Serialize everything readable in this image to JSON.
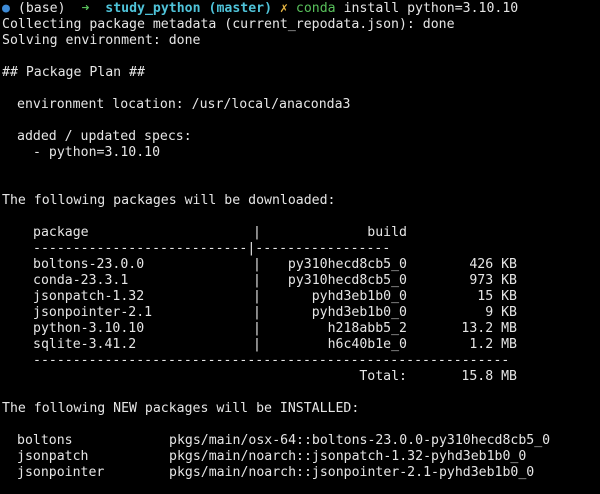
{
  "prompt": {
    "dot": "●",
    "env": "(base)",
    "arrow": "➜",
    "dir": "study_python",
    "branch": "(master)",
    "dirty": "✗",
    "command_name": "conda",
    "command_args": "install python=3.10.10"
  },
  "collect_line": "Collecting package metadata (current_repodata.json): done",
  "solve_line": "Solving environment: done",
  "plan_heading": "## Package Plan ##",
  "env_location": "environment location: /usr/local/anaconda3",
  "specs_heading": "added / updated specs:",
  "specs": [
    "- python=3.10.10"
  ],
  "download_heading": "The following packages will be downloaded:",
  "table": {
    "col_package": "package",
    "col_build": "build",
    "header_rule": "---------------------------|-----------------",
    "rows": [
      {
        "package": "boltons-23.0.0",
        "build": "py310hecd8cb5_0",
        "size": "426 KB"
      },
      {
        "package": "conda-23.3.1",
        "build": "py310hecd8cb5_0",
        "size": "973 KB"
      },
      {
        "package": "jsonpatch-1.32",
        "build": "pyhd3eb1b0_0",
        "size": "15 KB"
      },
      {
        "package": "jsonpointer-2.1",
        "build": "pyhd3eb1b0_0",
        "size": "9 KB"
      },
      {
        "package": "python-3.10.10",
        "build": "h218abb5_2",
        "size": "13.2 MB"
      },
      {
        "package": "sqlite-3.41.2",
        "build": "h6c40b1e_0",
        "size": "1.2 MB"
      }
    ],
    "footer_rule": "------------------------------------------------------------",
    "total_label": "Total:",
    "total_value": "15.8 MB"
  },
  "install_heading": "The following NEW packages will be INSTALLED:",
  "installs": [
    {
      "name": "boltons",
      "source": "pkgs/main/osx-64::boltons-23.0.0-py310hecd8cb5_0"
    },
    {
      "name": "jsonpatch",
      "source": "pkgs/main/noarch::jsonpatch-1.32-pyhd3eb1b0_0"
    },
    {
      "name": "jsonpointer",
      "source": "pkgs/main/noarch::jsonpointer-2.1-pyhd3eb1b0_0"
    }
  ]
}
